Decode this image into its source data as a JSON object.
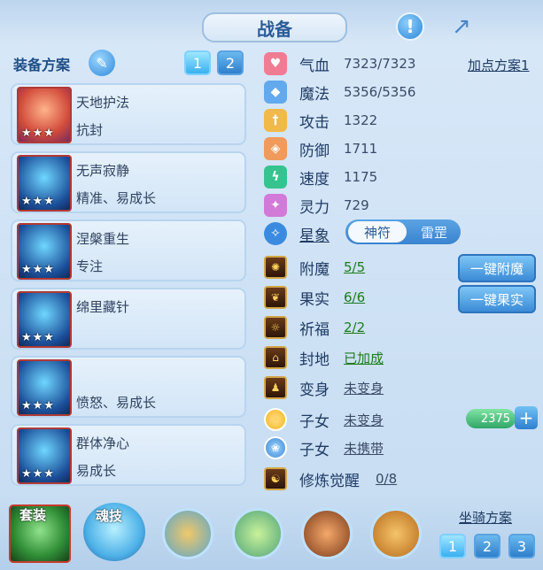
{
  "header": {
    "title": "战备",
    "icons": [
      "alert-icon",
      "share-icon"
    ]
  },
  "equipment": {
    "label": "装备方案",
    "schemes": [
      {
        "label": "1",
        "active": true
      },
      {
        "label": "2",
        "active": false
      }
    ],
    "items": [
      {
        "name": "天地护法",
        "attr": "抗封",
        "stars": "★★★",
        "icon": "scroll-icon"
      },
      {
        "name": "无声寂静",
        "attr": "精准、易成长",
        "stars": "★★★",
        "icon": "armor-icon"
      },
      {
        "name": "涅槃重生",
        "attr": "专注",
        "stars": "★★★",
        "icon": "crown-icon"
      },
      {
        "name": "绵里藏针",
        "attr": "",
        "stars": "★★★",
        "icon": "armor-icon"
      },
      {
        "name": "",
        "attr": "愤怒、易成长",
        "stars": "★★★",
        "icon": "helmet-icon"
      },
      {
        "name": "群体净心",
        "attr": "易成长",
        "stars": "★★★",
        "icon": "armor-icon"
      }
    ]
  },
  "stats": {
    "plan_link": "加点方案1",
    "rows": [
      {
        "label": "气血",
        "value": "7323/7323",
        "icon": "heart-icon",
        "color": "#f07c93"
      },
      {
        "label": "魔法",
        "value": "5356/5356",
        "icon": "mana-icon",
        "color": "#63a9ee"
      },
      {
        "label": "攻击",
        "value": "1322",
        "icon": "sword-icon",
        "color": "#f1b94a"
      },
      {
        "label": "防御",
        "value": "1711",
        "icon": "shield-icon",
        "color": "#f09a5b"
      },
      {
        "label": "速度",
        "value": "1175",
        "icon": "speed-icon",
        "color": "#35c48f"
      },
      {
        "label": "灵力",
        "value": "729",
        "icon": "spirit-icon",
        "color": "#d27ad7"
      }
    ],
    "star": {
      "label": "星象",
      "options": [
        "神符",
        "雷罡"
      ],
      "selected": "神符"
    }
  },
  "enhancements": [
    {
      "label": "附魔",
      "value": "5/5",
      "icon": "enchant-icon"
    },
    {
      "label": "果实",
      "value": "6/6",
      "icon": "fruit-icon"
    },
    {
      "label": "祈福",
      "value": "2/2",
      "icon": "blessing-icon"
    },
    {
      "label": "封地",
      "value": "已加成",
      "icon": "fief-icon"
    },
    {
      "label": "变身",
      "value": "未变身",
      "icon": "transform-icon"
    },
    {
      "label": "子女",
      "value": "未变身",
      "icon": "child-icon"
    },
    {
      "label": "子女",
      "value": "未携带",
      "icon": "paw-icon"
    },
    {
      "label": "修炼觉醒",
      "value": "0/8",
      "icon": "meditation-icon"
    }
  ],
  "actions": {
    "enchant": "一键附魔",
    "fruit": "一键果实"
  },
  "child_counter": {
    "value": "2375",
    "plus": "+"
  },
  "bottom": {
    "suit": "套装",
    "soul": "魂技",
    "mount_plan": "坐骑方案",
    "mount_schemes": [
      {
        "label": "1",
        "active": true
      },
      {
        "label": "2",
        "active": false
      },
      {
        "label": "3",
        "active": false
      }
    ],
    "mount_slots": [
      "mount-slot-1",
      "mount-slot-2",
      "mount-slot-3",
      "mount-slot-4",
      "mount-slot-5"
    ]
  }
}
